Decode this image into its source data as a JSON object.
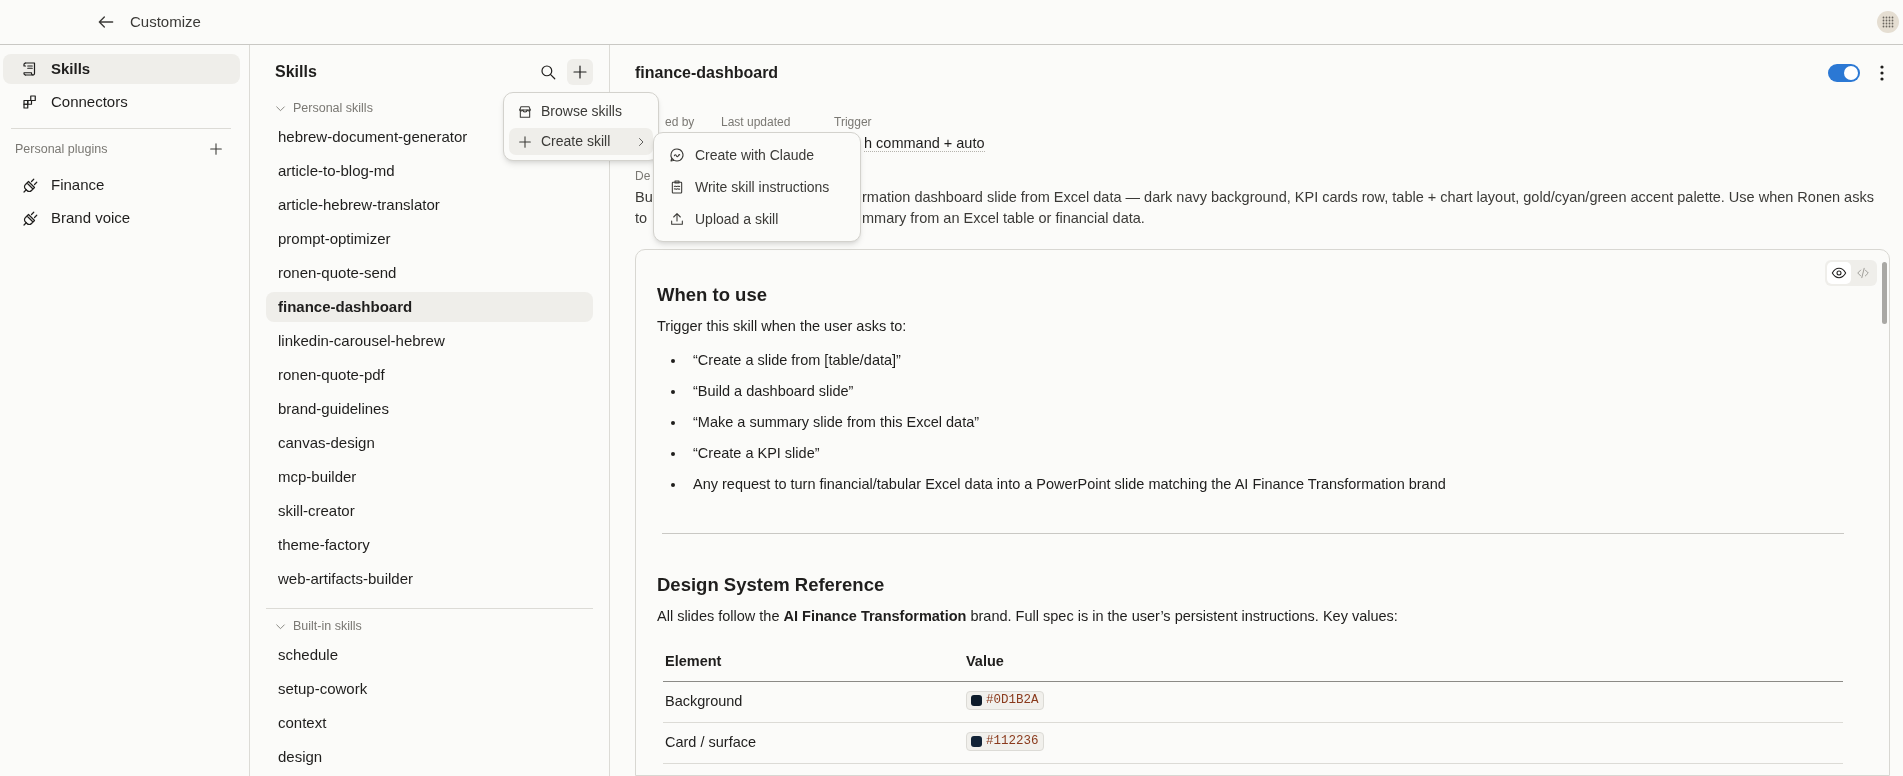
{
  "top_bar": {
    "back_label": "Customize"
  },
  "sidebar": {
    "nav": [
      {
        "label": "Skills",
        "selected": true
      },
      {
        "label": "Connectors",
        "selected": false
      }
    ],
    "plugins_heading": "Personal plugins",
    "plugins": [
      {
        "label": "Finance"
      },
      {
        "label": "Brand voice"
      }
    ]
  },
  "skills_panel": {
    "title": "Skills",
    "sections": [
      {
        "label": "Personal skills",
        "expanded": true,
        "items": [
          {
            "label": "hebrew-document-generator",
            "selected": false
          },
          {
            "label": "article-to-blog-md",
            "selected": false
          },
          {
            "label": "article-hebrew-translator",
            "selected": false
          },
          {
            "label": "prompt-optimizer",
            "selected": false
          },
          {
            "label": "ronen-quote-send",
            "selected": false
          },
          {
            "label": "finance-dashboard",
            "selected": true
          },
          {
            "label": "linkedin-carousel-hebrew",
            "selected": false
          },
          {
            "label": "ronen-quote-pdf",
            "selected": false
          },
          {
            "label": "brand-guidelines",
            "selected": false
          },
          {
            "label": "canvas-design",
            "selected": false
          },
          {
            "label": "mcp-builder",
            "selected": false
          },
          {
            "label": "skill-creator",
            "selected": false
          },
          {
            "label": "theme-factory",
            "selected": false
          },
          {
            "label": "web-artifacts-builder",
            "selected": false
          }
        ]
      },
      {
        "label": "Built-in skills",
        "expanded": true,
        "items": [
          {
            "label": "schedule",
            "selected": false
          },
          {
            "label": "setup-cowork",
            "selected": false
          },
          {
            "label": "context",
            "selected": false
          },
          {
            "label": "design",
            "selected": false
          }
        ]
      }
    ]
  },
  "menu": {
    "items": [
      {
        "label": "Browse skills",
        "highlighted": false,
        "has_submenu": false
      },
      {
        "label": "Create skill",
        "highlighted": true,
        "has_submenu": true
      }
    ]
  },
  "submenu": {
    "items": [
      {
        "label": "Create with Claude"
      },
      {
        "label": "Write skill instructions"
      },
      {
        "label": "Upload a skill"
      }
    ]
  },
  "detail": {
    "title": "finance-dashboard",
    "enabled": true,
    "meta": [
      {
        "label": "ed by"
      },
      {
        "label": "Last updated"
      },
      {
        "label": "Trigger",
        "value": "h command + auto"
      }
    ],
    "description_label": "De",
    "description_lines": [
      [
        "Bu",
        "rmation dashboard slide from Excel data — dark navy background, KPI cards row, table + chart layout, gold/cyan/green accent palette. Use when Ronen asks"
      ],
      [
        "to",
        "mmary from an Excel table or financial data."
      ]
    ]
  },
  "document": {
    "view_modes": [
      {
        "kind": "preview",
        "selected": true
      },
      {
        "kind": "code",
        "selected": false
      }
    ],
    "blocks": [
      {
        "kind": "heading",
        "text": "When to use"
      },
      {
        "kind": "paragraph",
        "text": "Trigger this skill when the user asks to:"
      },
      {
        "kind": "list",
        "items": [
          "“Create a slide from [table/data]”",
          "“Build a dashboard slide”",
          "“Make a summary slide from this Excel data”",
          "“Create a KPI slide”",
          "Any request to turn financial/tabular Excel data into a PowerPoint slide matching the AI Finance Transformation brand"
        ]
      },
      {
        "kind": "divider"
      },
      {
        "kind": "heading",
        "text": "Design System Reference"
      },
      {
        "kind": "paragraph",
        "text": "All slides follow the **AI Finance Transformation** brand. Full spec is in the user’s persistent instructions. Key values:"
      },
      {
        "kind": "table",
        "columns": [
          "Element",
          "Value"
        ],
        "rows": [
          {
            "element": "Background",
            "value": "#0D1B2A",
            "color": "#0d1b2a"
          },
          {
            "element": "Card / surface",
            "value": "#112236",
            "color": "#112236"
          }
        ]
      }
    ]
  }
}
